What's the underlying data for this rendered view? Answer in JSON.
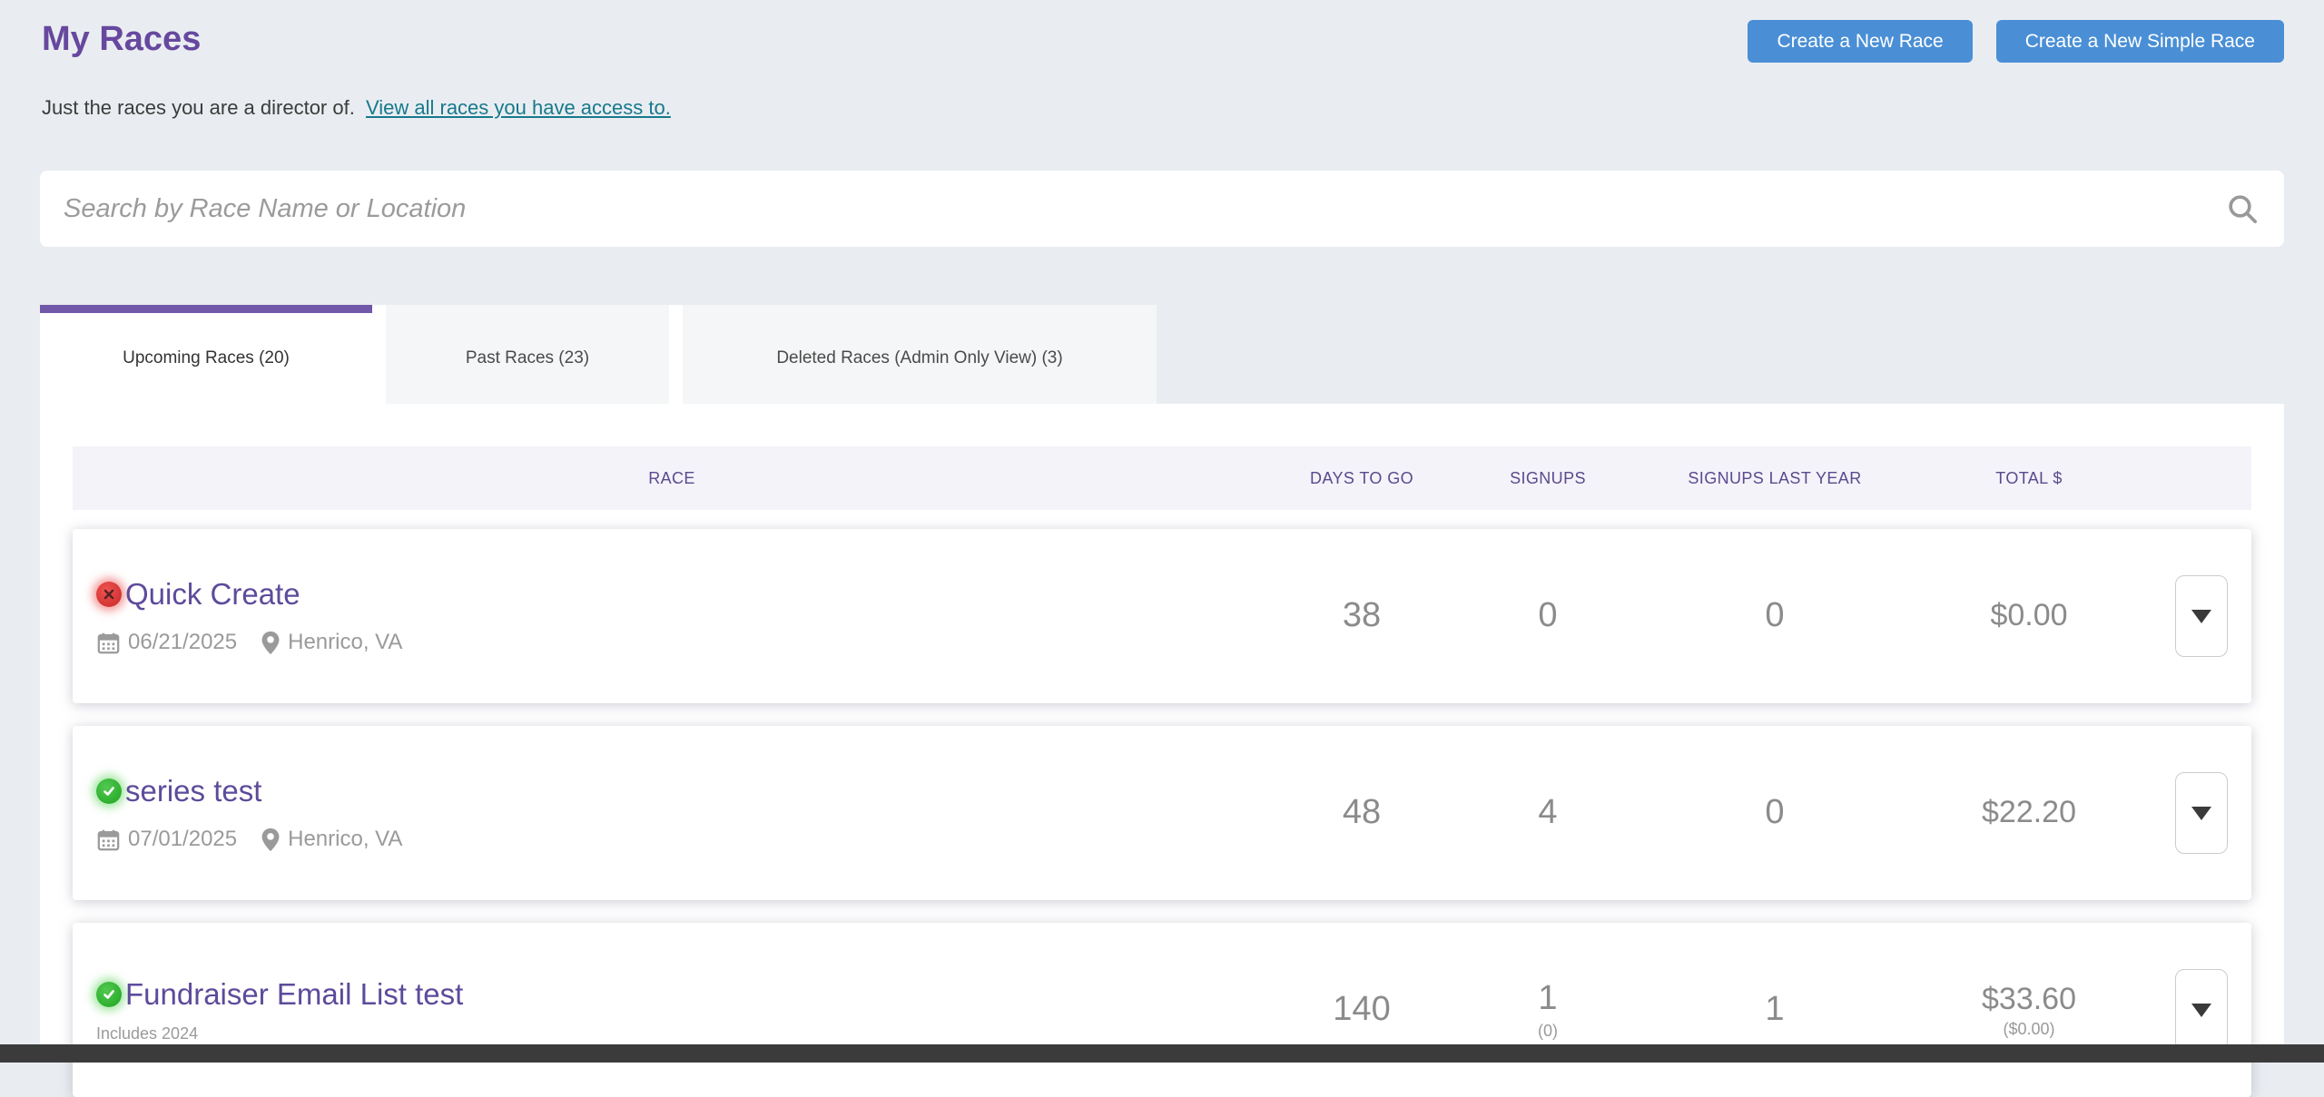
{
  "page": {
    "title": "My Races",
    "subtitle": "Just the races you are a director of.",
    "subtitle_link": "View all races you have access to."
  },
  "header_buttons": {
    "create_race": "Create a New Race",
    "create_simple_race": "Create a New Simple Race"
  },
  "search": {
    "placeholder": "Search by Race Name or Location",
    "icon": "search-icon"
  },
  "tabs": [
    {
      "label": "Upcoming Races (20)",
      "active": true
    },
    {
      "label": "Past Races (23)",
      "active": false
    },
    {
      "label": "Deleted Races (Admin Only View) (3)",
      "active": false
    }
  ],
  "table": {
    "columns": [
      "RACE",
      "DAYS TO GO",
      "SIGNUPS",
      "SIGNUPS LAST YEAR",
      "TOTAL $"
    ],
    "rows": [
      {
        "status": "error",
        "status_icon": "red-x-icon",
        "name": "Quick Create",
        "date": "06/21/2025",
        "location": "Henrico, VA",
        "days_to_go": "38",
        "signups": "0",
        "signups_last_year": "0",
        "total": "$0.00"
      },
      {
        "status": "ok",
        "status_icon": "green-check-icon",
        "name": "series test",
        "date": "07/01/2025",
        "location": "Henrico, VA",
        "days_to_go": "48",
        "signups": "4",
        "signups_last_year": "0",
        "total": "$22.20"
      },
      {
        "status": "ok",
        "status_icon": "green-check-icon",
        "name": "Fundraiser Email List test",
        "note": "Includes 2024",
        "days_to_go": "140",
        "signups": "1",
        "signups_sub": "(0)",
        "signups_last_year": "1",
        "total": "$33.60",
        "total_sub": "($0.00)"
      }
    ]
  },
  "colors": {
    "accent_purple": "#67489e",
    "tab_accent": "#7158a8",
    "button_blue": "#4a8fd6",
    "link_teal": "#17798c",
    "header_text_purple": "#5b4a8e",
    "status_red": "#c62828",
    "status_green": "#1ea31e",
    "page_background": "#e9edf1",
    "header_row_background": "#f4f3f9"
  }
}
